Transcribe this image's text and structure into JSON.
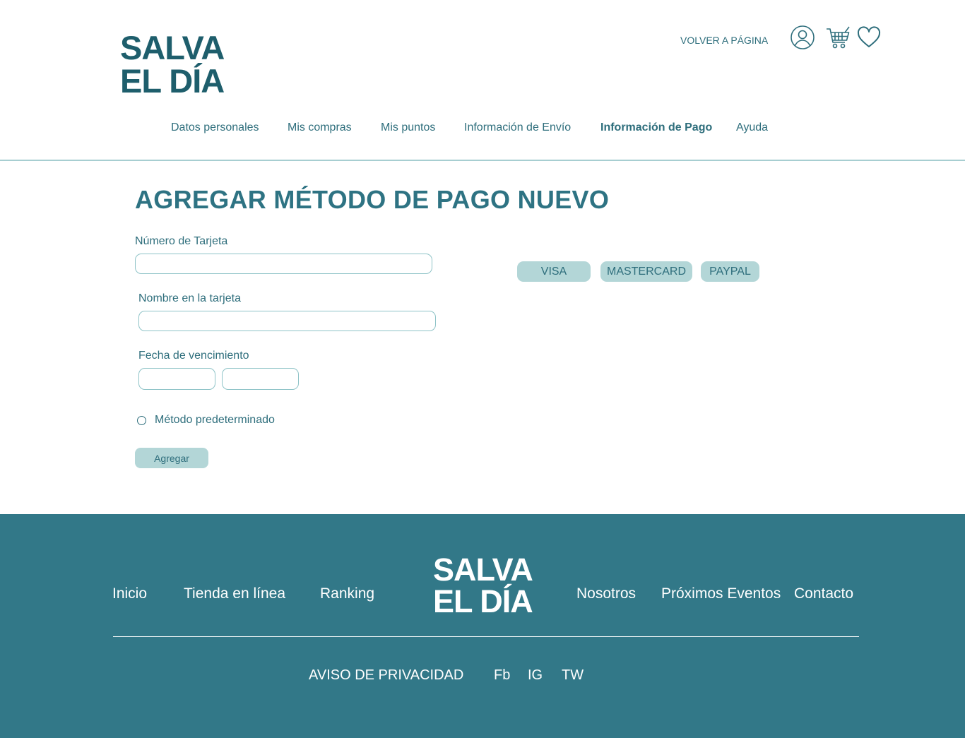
{
  "header": {
    "logo_line1": "SALVA",
    "logo_line2": "EL DÍA",
    "back_link": "VOLVER A PÁGINA",
    "icons": [
      "user-icon",
      "cart-icon",
      "heart-icon"
    ]
  },
  "tabs": [
    {
      "label": "Datos personales",
      "active": false
    },
    {
      "label": "Mis compras",
      "active": false
    },
    {
      "label": "Mis puntos",
      "active": false
    },
    {
      "label": "Información de Envío",
      "active": false
    },
    {
      "label": "Información de Pago",
      "active": true
    },
    {
      "label": "Ayuda",
      "active": false
    }
  ],
  "form": {
    "title": "AGREGAR MÉTODO DE PAGO NUEVO",
    "card_number_label": "Número de Tarjeta",
    "card_number_value": "",
    "card_name_label": "Nombre en la tarjeta",
    "card_name_value": "",
    "expiry_label": "Fecha de vencimiento",
    "expiry_month_value": "",
    "expiry_year_value": "",
    "default_method_label": "Método predeterminado",
    "default_method_checked": false,
    "add_button": "Agregar"
  },
  "payment_methods": [
    "VISA",
    "MASTERCARD",
    "PAYPAL"
  ],
  "footer": {
    "links": [
      "Inicio",
      "Tienda en línea",
      "Ranking",
      "Nosotros",
      "Próximos Eventos",
      "Contacto"
    ],
    "logo_line1": "SALVA",
    "logo_line2": "EL DÍA",
    "privacy": "AVISO DE PRIVACIDAD",
    "social": [
      "Fb",
      "IG",
      "TW"
    ]
  },
  "colors": {
    "primary": "#2e6e7c",
    "logo": "#1e5e6c",
    "chip_bg": "#b3d6d7",
    "footer_bg": "#327888",
    "input_border": "#8ec3c7"
  }
}
